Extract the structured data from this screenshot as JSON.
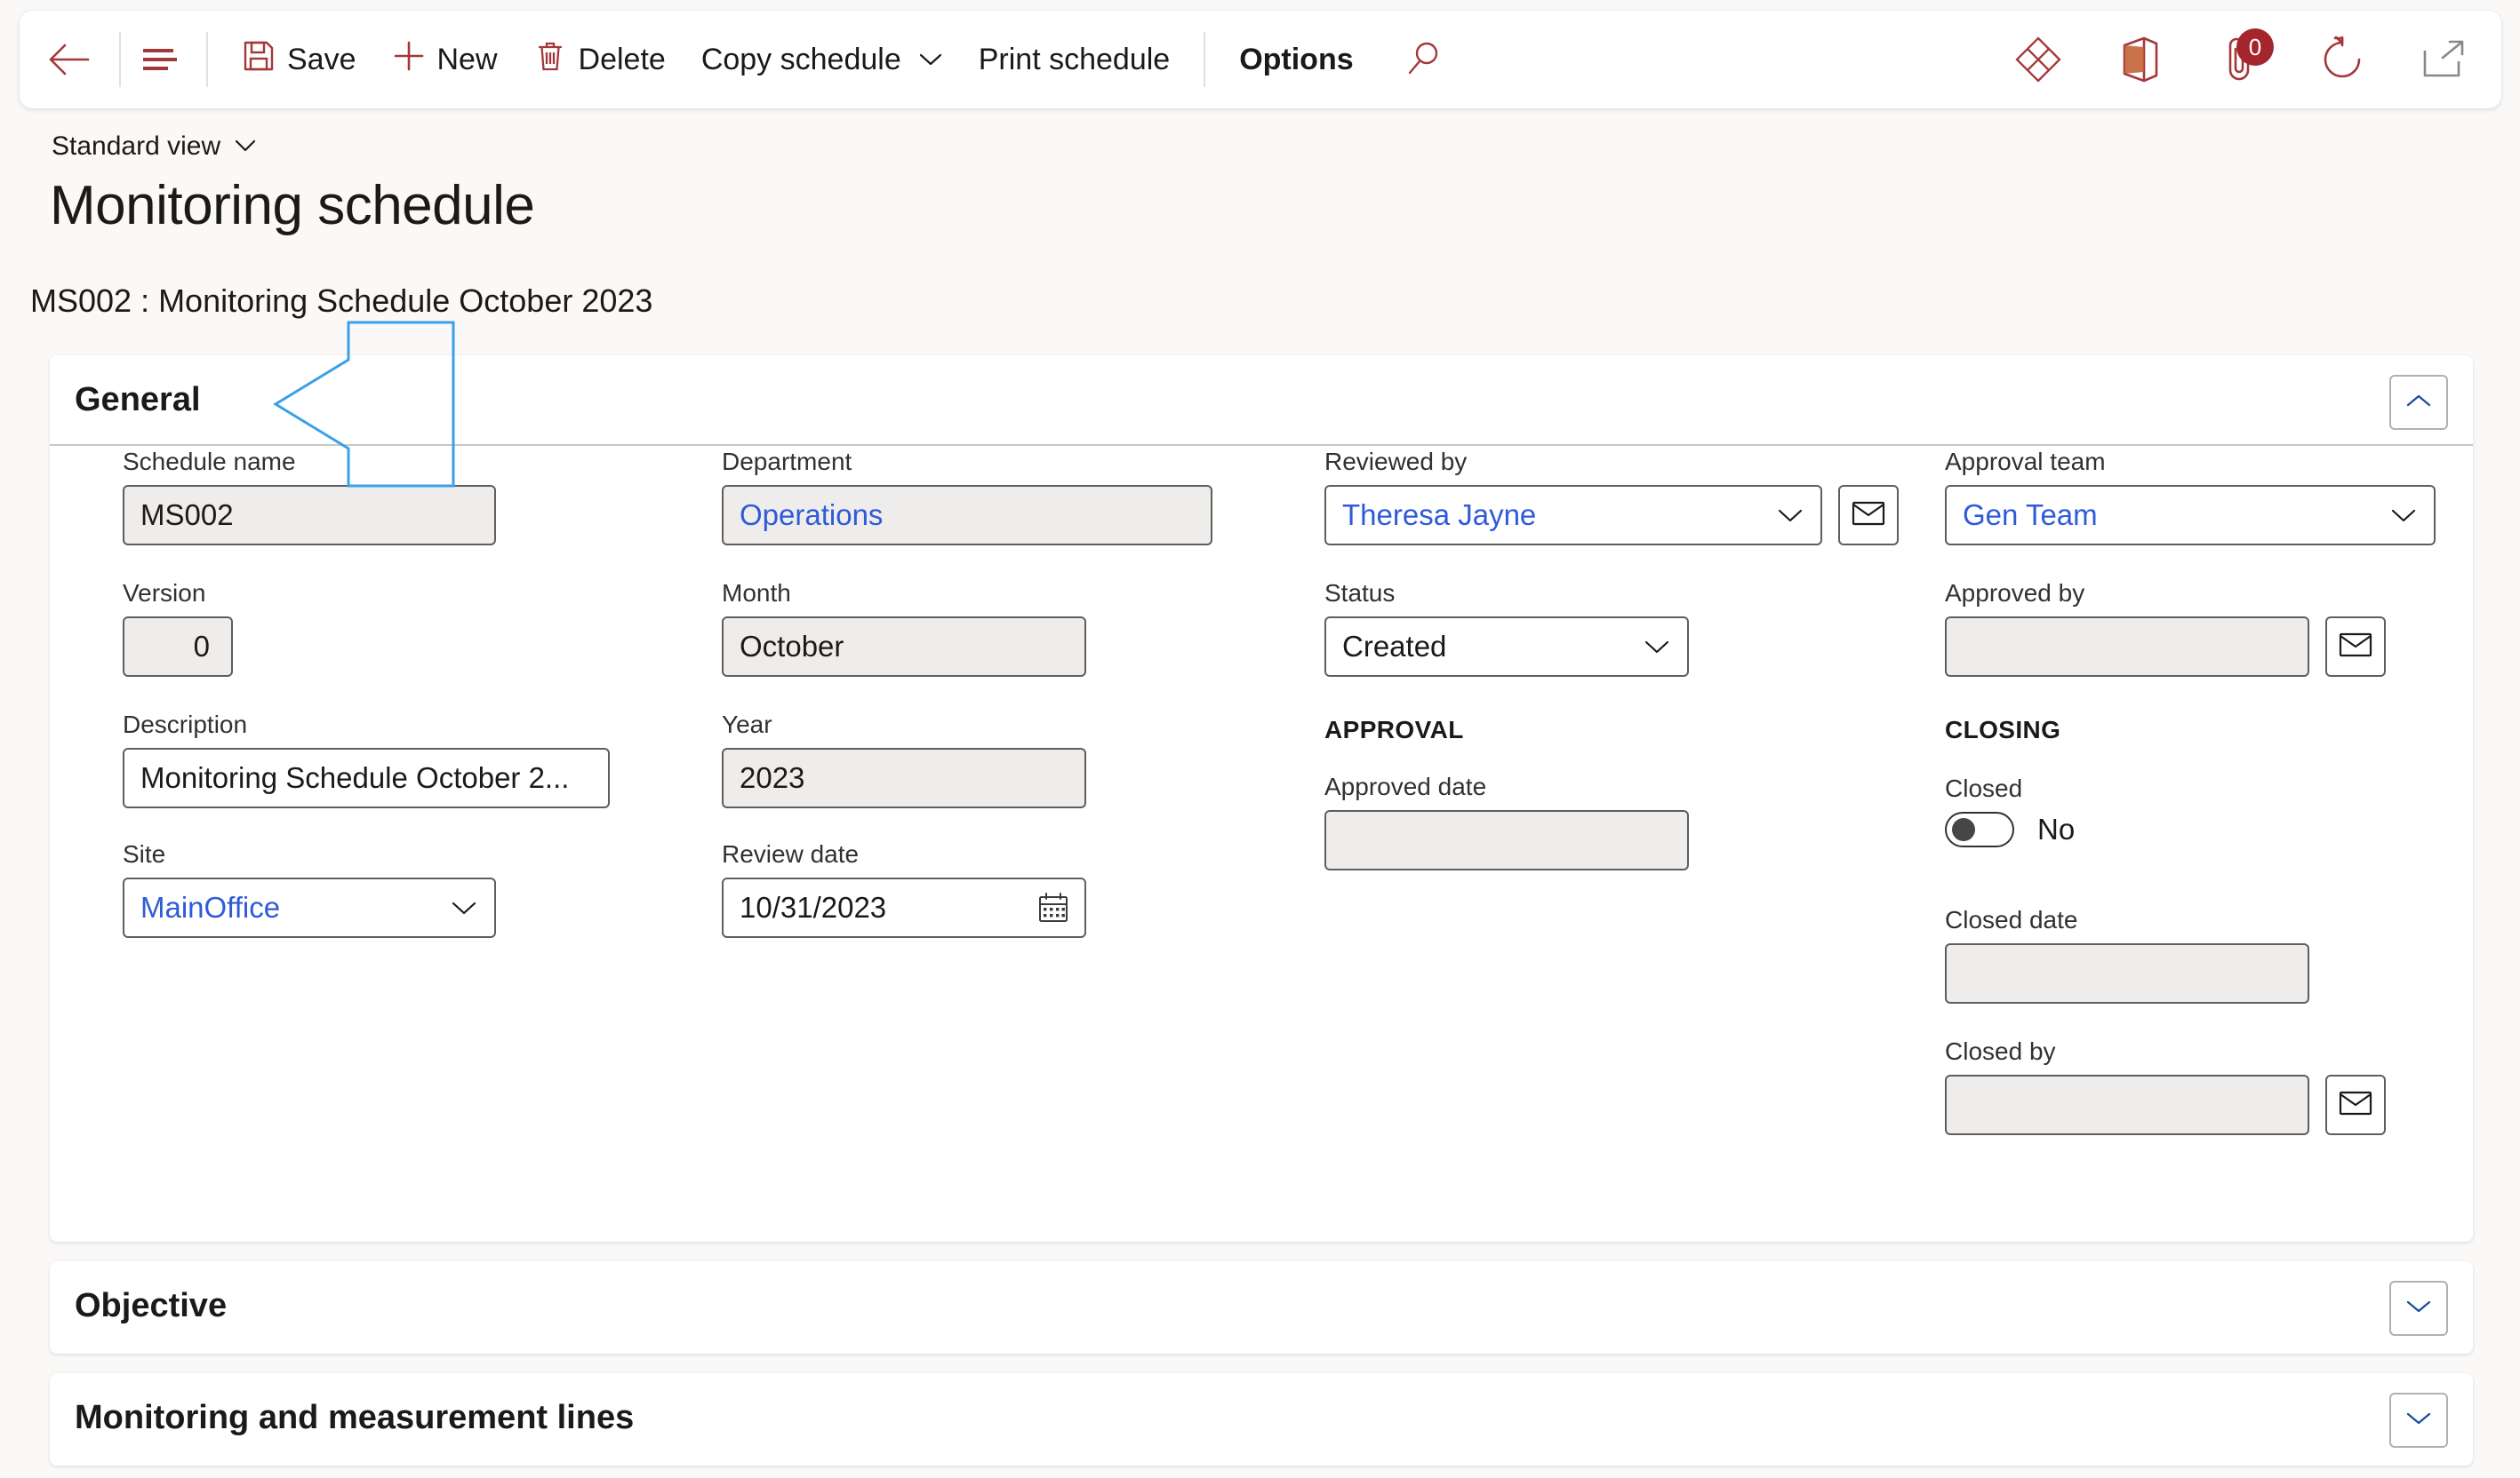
{
  "toolbar": {
    "back_icon": "back-arrow-icon",
    "list_icon": "show-list-icon",
    "items": [
      {
        "label": "Save",
        "icon": "save-icon",
        "has_chevron": false,
        "bold": false
      },
      {
        "label": "New",
        "icon": "add-icon",
        "has_chevron": false,
        "bold": false
      },
      {
        "label": "Delete",
        "icon": "trash-icon",
        "has_chevron": false,
        "bold": false
      },
      {
        "label": "Copy schedule",
        "icon": "",
        "has_chevron": true,
        "bold": false
      },
      {
        "label": "Print schedule",
        "icon": "",
        "has_chevron": false,
        "bold": false
      },
      {
        "label": "Options",
        "icon": "",
        "has_chevron": false,
        "bold": true
      }
    ],
    "search_icon": "search-icon",
    "right_icons": [
      {
        "name": "dynamics-diamond-icon"
      },
      {
        "name": "office-app-icon"
      },
      {
        "name": "attachment-icon",
        "badge": "0"
      },
      {
        "name": "refresh-icon"
      },
      {
        "name": "open-in-new-window-icon"
      }
    ],
    "accent_color": "#a4373a"
  },
  "header": {
    "view_selector": "Standard view",
    "view_chevron_icon": "chevron-down-icon",
    "page_title": "Monitoring schedule",
    "record_caption": "MS002 : Monitoring Schedule October 2023"
  },
  "annotation": {
    "shape": "left-pointing-arrow",
    "color": "#3aa0e8",
    "points_to": "General"
  },
  "sections": {
    "general": {
      "title": "General",
      "expanded": true,
      "collapse_icon": "chevron-up-icon"
    },
    "objective": {
      "title": "Objective",
      "expanded": false,
      "collapse_icon": "chevron-down-icon"
    },
    "lines": {
      "title": "Monitoring and measurement lines",
      "expanded": false,
      "collapse_icon": "chevron-down-icon"
    }
  },
  "general_form": {
    "column1": {
      "schedule_name": {
        "label": "Schedule name",
        "value": "MS002",
        "readonly": true
      },
      "version": {
        "label": "Version",
        "value": "0",
        "readonly": true
      },
      "description": {
        "label": "Description",
        "value": "Monitoring Schedule October 2...",
        "readonly": false
      },
      "site": {
        "label": "Site",
        "value": "MainOffice",
        "readonly": false,
        "is_link": true,
        "chevron_icon": "chevron-down-icon"
      }
    },
    "column2": {
      "department": {
        "label": "Department",
        "value": "Operations",
        "readonly": true,
        "is_link": true
      },
      "month": {
        "label": "Month",
        "value": "October",
        "readonly": true
      },
      "year": {
        "label": "Year",
        "value": "2023",
        "readonly": true
      },
      "review_date": {
        "label": "Review date",
        "value": "10/31/2023",
        "readonly": false,
        "calendar_icon": "calendar-icon"
      }
    },
    "column3": {
      "reviewed_by": {
        "label": "Reviewed by",
        "value": "Theresa Jayne",
        "readonly": false,
        "is_link": true,
        "chevron_icon": "chevron-down-icon",
        "mail_icon": "mail-icon"
      },
      "status": {
        "label": "Status",
        "value": "Created",
        "readonly": false,
        "chevron_icon": "chevron-down-icon"
      },
      "approval_heading": "APPROVAL",
      "approved_date": {
        "label": "Approved date",
        "value": "",
        "readonly": true
      }
    },
    "column4": {
      "approval_team": {
        "label": "Approval team",
        "value": "Gen Team",
        "readonly": false,
        "is_link": true,
        "chevron_icon": "chevron-down-icon"
      },
      "approved_by": {
        "label": "Approved by",
        "value": "",
        "readonly": true,
        "mail_icon": "mail-icon"
      },
      "closing_heading": "CLOSING",
      "closed": {
        "label": "Closed",
        "value": "No",
        "checked": false
      },
      "closed_date": {
        "label": "Closed date",
        "value": "",
        "readonly": true
      },
      "closed_by": {
        "label": "Closed by",
        "value": "",
        "readonly": true,
        "mail_icon": "mail-icon"
      }
    }
  }
}
